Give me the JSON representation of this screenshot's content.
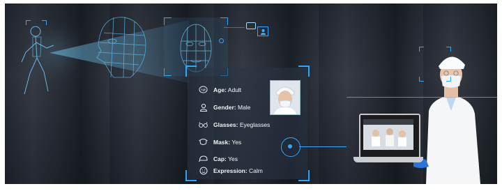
{
  "attributes": [
    {
      "icon": "age-icon",
      "label": "Age:",
      "value": "Adult"
    },
    {
      "icon": "gender-icon",
      "label": "Gender:",
      "value": "Male"
    },
    {
      "icon": "glasses-icon",
      "label": "Glasses:",
      "value": "Eyeglasses"
    },
    {
      "icon": "mask-icon",
      "label": "Mask:",
      "value": "Yes"
    },
    {
      "icon": "cap-icon",
      "label": "Cap:",
      "value": "Yes"
    },
    {
      "icon": "expression-icon",
      "label": "Expression:",
      "value": "Calm"
    }
  ],
  "age_badge": "Age",
  "colors": {
    "accent": "#2aa8ff",
    "panel": "#283446"
  }
}
